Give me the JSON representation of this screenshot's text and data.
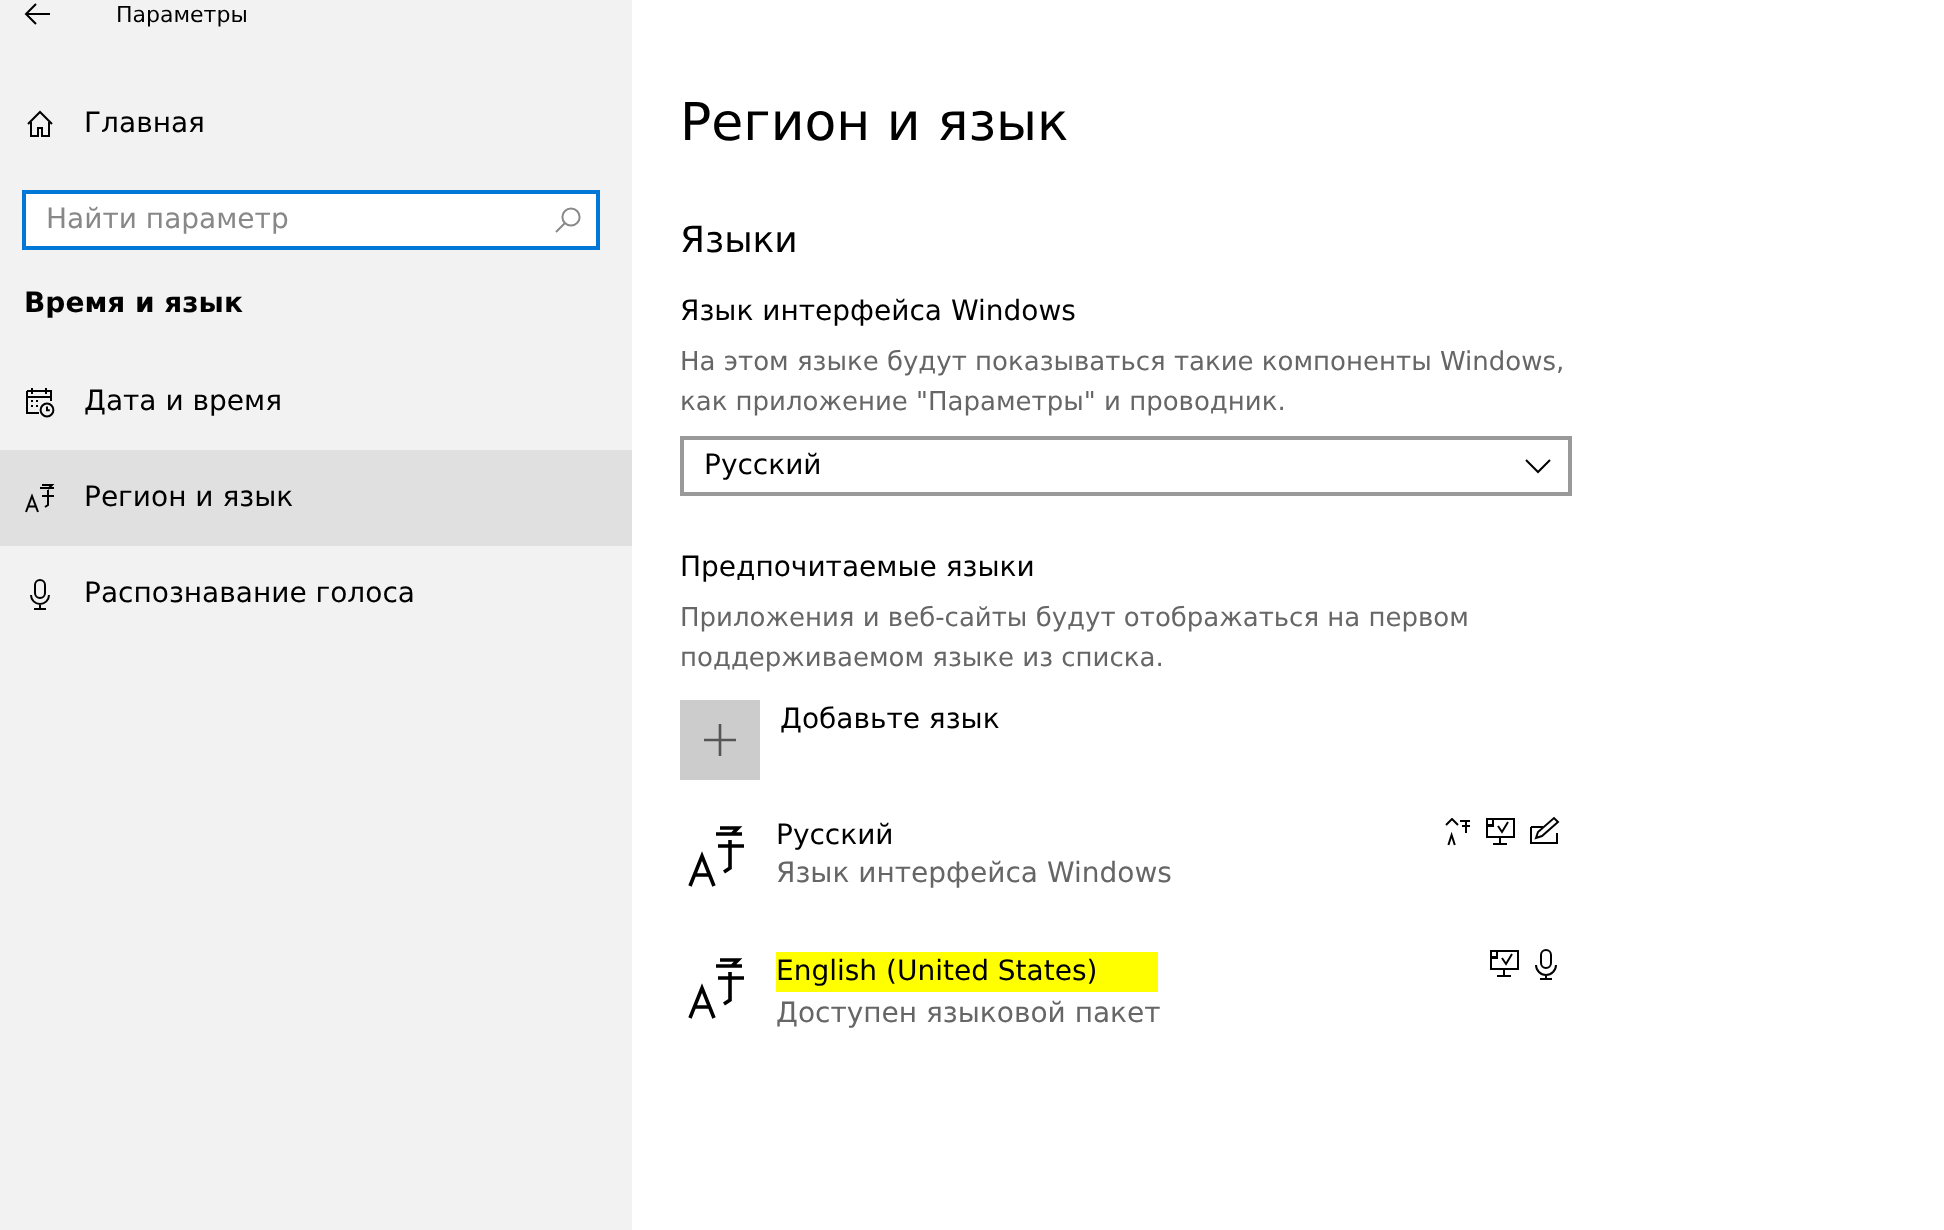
{
  "window": {
    "title": "Параметры"
  },
  "sidebar": {
    "home": "Главная",
    "search": {
      "placeholder": "Найти параметр"
    },
    "section": "Время и язык",
    "items": [
      {
        "label": "Дата и время",
        "kind": "calendar",
        "selected": false
      },
      {
        "label": "Регион и язык",
        "kind": "language",
        "selected": true
      },
      {
        "label": "Распознавание голоса",
        "kind": "microphone",
        "selected": false
      }
    ]
  },
  "main": {
    "title": "Регион и язык",
    "section": "Языки",
    "display_language": {
      "label": "Язык интерфейса Windows",
      "description": "На этом языке будут показываться такие компоненты Windows, как приложение \"Параметры\" и проводник.",
      "value": "Русский"
    },
    "preferred": {
      "label": "Предпочитаемые языки",
      "description": "Приложения и веб-сайты будут отображаться на первом поддерживаемом языке из списка.",
      "add": "Добавьте язык",
      "languages": [
        {
          "name": "Русский",
          "status": "Язык интерфейса Windows",
          "highlighted": false,
          "features": [
            {
              "kind": "display"
            },
            {
              "kind": "text"
            },
            {
              "kind": "handwriting"
            }
          ]
        },
        {
          "name": "English (United States)",
          "status": "Доступен языковой пакет",
          "highlighted": true,
          "features": [
            {
              "kind": "text"
            },
            {
              "kind": "speech"
            }
          ]
        }
      ]
    }
  }
}
